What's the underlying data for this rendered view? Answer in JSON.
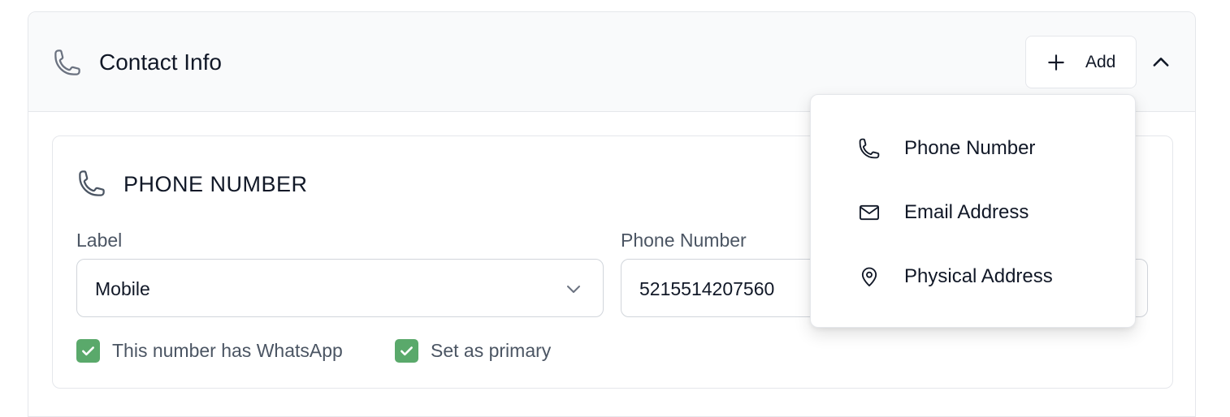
{
  "section": {
    "title": "Contact Info",
    "icon": "phone-icon",
    "add_button_label": "Add",
    "collapse_icon": "chevron-up-icon"
  },
  "phone_entry": {
    "title": "PHONE NUMBER",
    "label_field": {
      "label": "Label",
      "value": "Mobile"
    },
    "number_field": {
      "label": "Phone Number",
      "value": "5215514207560"
    },
    "checkboxes": [
      {
        "label": "This number has WhatsApp",
        "checked": true
      },
      {
        "label": "Set as primary",
        "checked": true
      }
    ]
  },
  "add_menu": {
    "items": [
      {
        "label": "Phone Number",
        "icon": "phone-icon"
      },
      {
        "label": "Email Address",
        "icon": "mail-icon"
      },
      {
        "label": "Physical Address",
        "icon": "map-pin-icon"
      }
    ]
  },
  "colors": {
    "checkbox": "#5aa96b",
    "header_bg": "#f9fafb",
    "border": "#e5e7eb"
  }
}
